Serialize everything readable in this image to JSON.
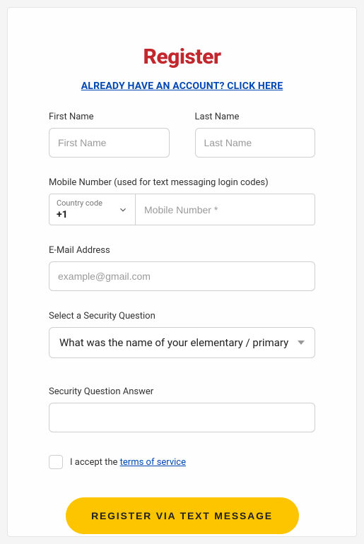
{
  "title": "Register",
  "loginLink": "ALREADY HAVE AN ACCOUNT? CLICK HERE",
  "firstName": {
    "label": "First Name",
    "placeholder": "First Name",
    "value": ""
  },
  "lastName": {
    "label": "Last Name",
    "placeholder": "Last Name",
    "value": ""
  },
  "mobile": {
    "label": "Mobile Number (used for text messaging login codes)",
    "countryLabel": "Country code",
    "countryValue": "+1",
    "placeholder": "Mobile Number *",
    "value": ""
  },
  "email": {
    "label": "E-Mail Address",
    "placeholder": "example@gmail.com",
    "value": ""
  },
  "securityQuestion": {
    "label": "Select a Security Question",
    "selected": "What was the name of your elementary / primary sch"
  },
  "securityAnswer": {
    "label": "Security Question Answer",
    "value": ""
  },
  "terms": {
    "prefix": "I accept the ",
    "linkText": "terms of service",
    "checked": false
  },
  "submit": "REGISTER VIA TEXT MESSAGE",
  "colors": {
    "accent": "#fdc500",
    "titleColor": "#c1272d",
    "link": "#0047b3"
  }
}
